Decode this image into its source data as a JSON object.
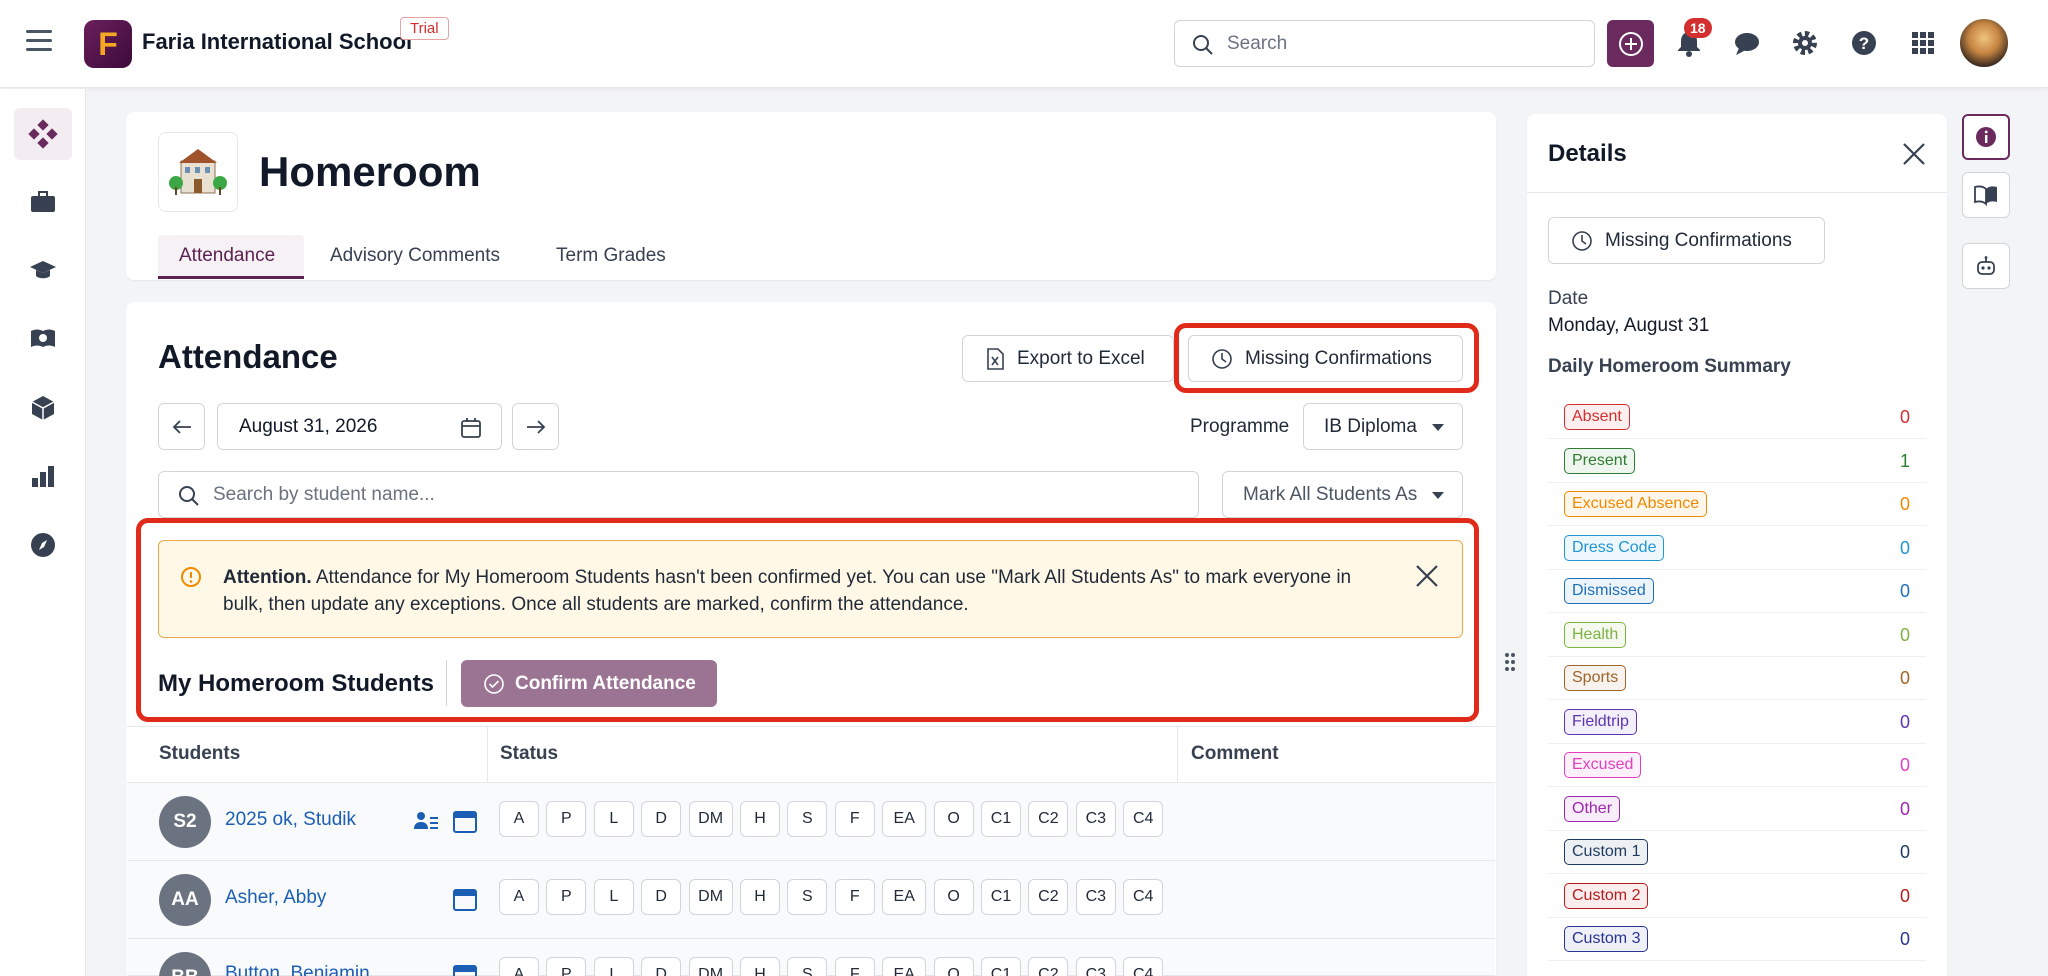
{
  "app": {
    "school_name": "Faria International School",
    "trial_label": "Trial",
    "logo_letter": "F",
    "search_placeholder": "Search",
    "notification_count": "18"
  },
  "page": {
    "title": "Homeroom",
    "tabs": [
      {
        "label": "Attendance",
        "active": true
      },
      {
        "label": "Advisory Comments",
        "active": false
      },
      {
        "label": "Term Grades",
        "active": false
      }
    ]
  },
  "attendance": {
    "title": "Attendance",
    "export_label": "Export to Excel",
    "missing_label": "Missing Confirmations",
    "date": "August 31, 2026",
    "programme_label": "Programme",
    "programme_value": "IB Diploma",
    "search_placeholder": "Search by student name...",
    "mark_all_label": "Mark All Students As",
    "alert_strong": "Attention.",
    "alert_text": " Attendance for My Homeroom Students hasn't been confirmed yet. You can use \"Mark All Students As\" to mark everyone in bulk, then update any exceptions. Once all students are marked, confirm the attendance.",
    "group_title": "My Homeroom Students",
    "confirm_label": "Confirm Attendance",
    "columns": [
      "Students",
      "Status",
      "Comment"
    ],
    "status_codes": [
      "A",
      "P",
      "L",
      "D",
      "DM",
      "H",
      "S",
      "F",
      "EA",
      "O",
      "C1",
      "C2",
      "C3",
      "C4"
    ],
    "students": [
      {
        "initials": "S2",
        "name": "2025 ok, Studik"
      },
      {
        "initials": "AA",
        "name": "Asher, Abby"
      },
      {
        "initials": "BB",
        "name": "Button, Benjamin"
      }
    ]
  },
  "details": {
    "title": "Details",
    "missing_label": "Missing Confirmations",
    "date_label": "Date",
    "date_value": "Monday, August 31",
    "summary_label": "Daily Homeroom Summary",
    "summary": [
      {
        "label": "Absent",
        "value": "0",
        "color": "#d32f2f"
      },
      {
        "label": "Present",
        "value": "1",
        "color": "#2e7d32"
      },
      {
        "label": "Excused Absence",
        "value": "0",
        "color": "#ef8a00"
      },
      {
        "label": "Dress Code",
        "value": "0",
        "color": "#2196d3"
      },
      {
        "label": "Dismissed",
        "value": "0",
        "color": "#1e6fb8"
      },
      {
        "label": "Health",
        "value": "0",
        "color": "#7cb342"
      },
      {
        "label": "Sports",
        "value": "0",
        "color": "#a0652a"
      },
      {
        "label": "Fieldtrip",
        "value": "0",
        "color": "#5e35b1"
      },
      {
        "label": "Excused",
        "value": "0",
        "color": "#e040c0"
      },
      {
        "label": "Other",
        "value": "0",
        "color": "#9c27b0"
      },
      {
        "label": "Custom 1",
        "value": "0",
        "color": "#1f3a5f"
      },
      {
        "label": "Custom 2",
        "value": "0",
        "color": "#b71c1c"
      },
      {
        "label": "Custom 3",
        "value": "0",
        "color": "#283593"
      }
    ]
  }
}
